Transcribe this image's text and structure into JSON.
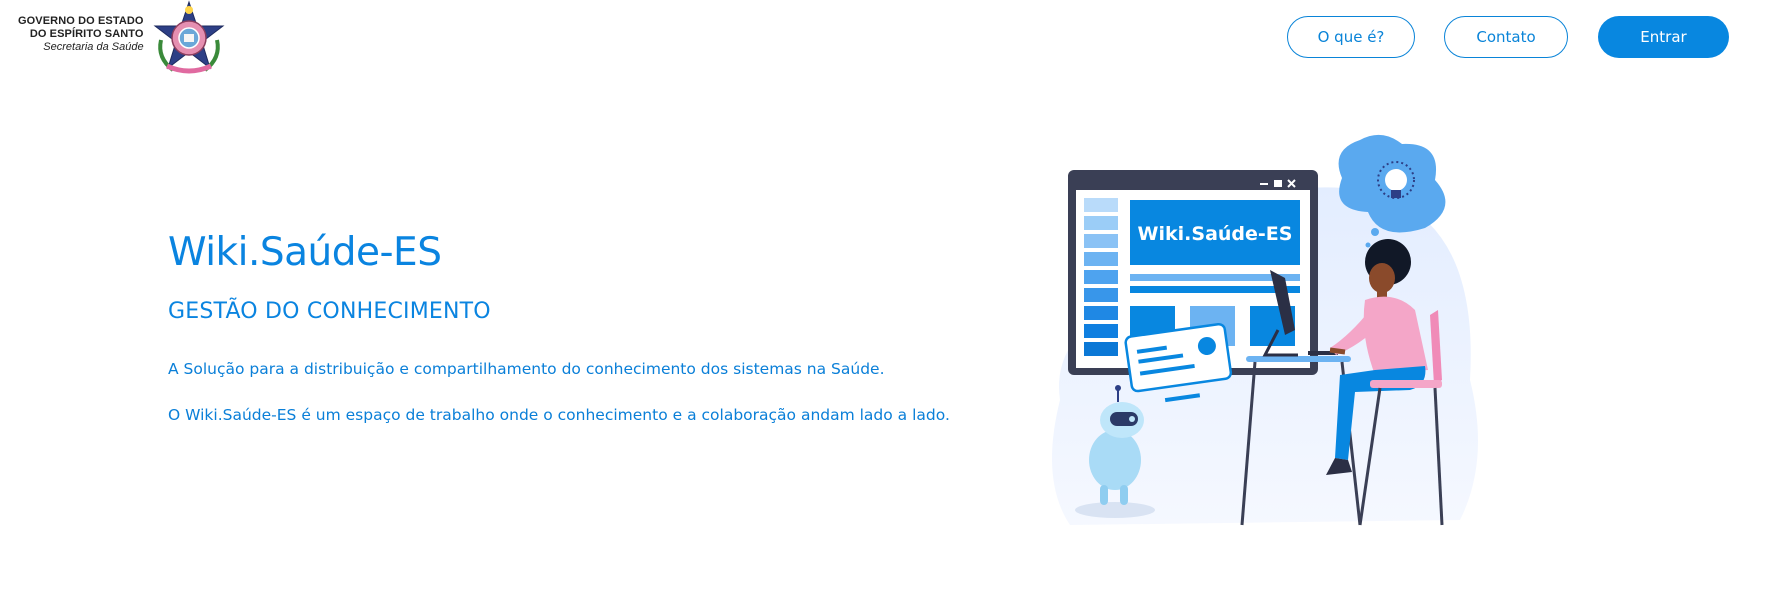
{
  "header": {
    "logo": {
      "line1": "GOVERNO DO ESTADO",
      "line2": "DO ESPÍRITO SANTO",
      "line3": "Secretaria da Saúde"
    },
    "nav": {
      "about_label": "O que é?",
      "contact_label": "Contato",
      "login_label": "Entrar"
    }
  },
  "hero": {
    "title": "Wiki.Saúde-ES",
    "subtitle": "GESTÃO DO CONHECIMENTO",
    "paragraph1": "A Solução para a distribuição e compartilhamento do conhecimento dos sistemas na Saúde.",
    "paragraph2": "O Wiki.Saúde-ES é um espaço de trabalho onde o conhecimento e a colaboração andam lado a lado."
  },
  "illustration": {
    "screen_title": "Wiki.Saúde-ES"
  },
  "colors": {
    "brand_blue": "#0887e0",
    "light_blue": "#7ec0f5",
    "pink": "#f4a6c8"
  }
}
